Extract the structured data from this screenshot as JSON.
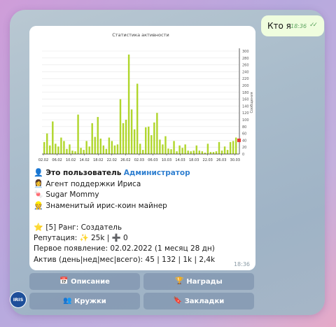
{
  "outgoing": {
    "text": "Кто я",
    "time": "18:36",
    "checks": "✓✓"
  },
  "chart_data": {
    "type": "bar",
    "title": "Статистика активности",
    "ylabel": "Сообщения",
    "ylim": [
      0,
      300
    ],
    "yticks": [
      "0",
      "20",
      "40",
      "60",
      "80",
      "100",
      "120",
      "140",
      "160",
      "180",
      "200",
      "220",
      "240",
      "260",
      "280",
      "300"
    ],
    "xticks": [
      "02.02",
      "06.02",
      "10.02",
      "14.02",
      "18.02",
      "22.02",
      "26.02",
      "02.03",
      "06.03",
      "10.03",
      "14.03",
      "18.03",
      "22.03",
      "26.03",
      "30.03"
    ],
    "values": [
      35,
      60,
      25,
      95,
      30,
      22,
      48,
      38,
      15,
      28,
      10,
      8,
      115,
      18,
      12,
      38,
      22,
      90,
      50,
      108,
      45,
      25,
      15,
      48,
      38,
      25,
      28,
      160,
      90,
      100,
      290,
      130,
      72,
      205,
      30,
      12,
      78,
      80,
      55,
      92,
      120,
      42,
      28,
      52,
      16,
      14,
      38,
      8,
      25,
      18,
      28,
      10,
      8,
      10,
      25,
      10,
      8,
      4,
      30,
      6,
      6,
      8,
      35,
      10,
      22,
      12,
      35,
      38,
      48
    ],
    "current_value": 40,
    "colors": {
      "bar": "#b0d62c",
      "current": "#e53935",
      "axis": "#333333",
      "grid": "#e7e7e7"
    }
  },
  "message": {
    "line1_prefix": "Это пользователь",
    "line1_role": "Администратор",
    "line2": "Агент поддержки Ириса",
    "line3": "Sugar Mommy",
    "line4": "Знаменитый ирис-коин майнер",
    "rank": "[5] Ранг: Создатель",
    "reputation": "Репутация: ✨ 25k | ➕ 0",
    "first_seen": "Первое появление: 02.02.2022 (1 месяц 28 дн)",
    "activity": "Актив (день|нед|мес|всего): 45 | 132 | 1k | 2,4k",
    "time": "18:36"
  },
  "keyboard": {
    "description": "Описание",
    "awards": "Награды",
    "clubs": "Кружки",
    "bookmarks": "Закладки"
  },
  "avatar_text": "IRIS"
}
